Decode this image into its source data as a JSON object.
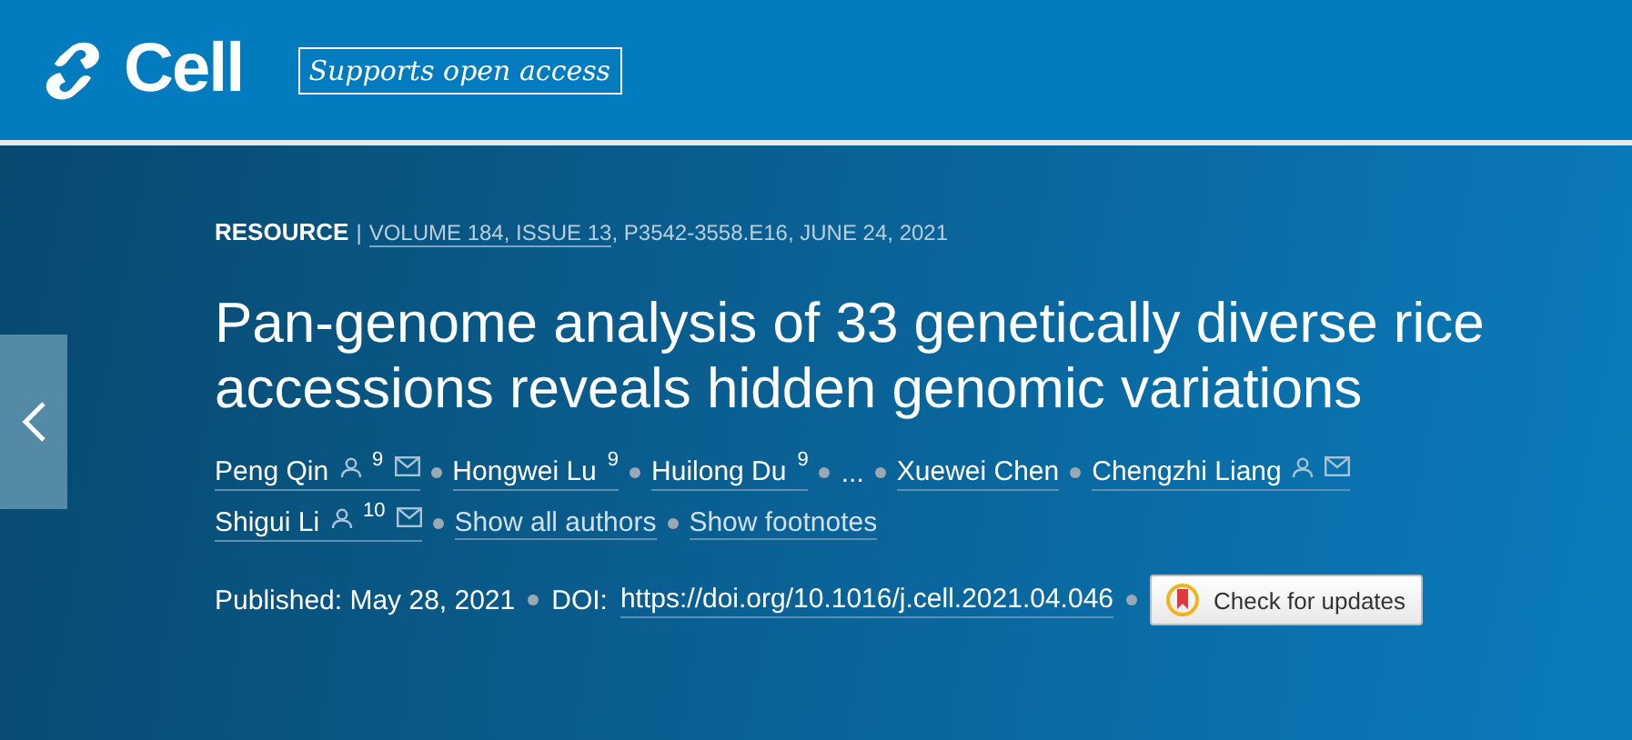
{
  "header": {
    "brand": "Cell",
    "badge": "Supports open access"
  },
  "article": {
    "type": "RESOURCE",
    "divider": "|",
    "issue_link": "VOLUME 184, ISSUE 13",
    "issue_rest": ", P3542-3558.E16, JUNE 24, 2021",
    "title": "Pan-genome analysis of 33 genetically diverse rice accessions reveals hidden genomic variations",
    "author_lines": [
      [
        {
          "kind": "author",
          "name": "Peng Qin",
          "person": true,
          "note": "9",
          "email": true
        },
        {
          "kind": "author",
          "name": "Hongwei Lu",
          "person": false,
          "note": "9",
          "email": false
        },
        {
          "kind": "author",
          "name": "Huilong Du",
          "person": false,
          "note": "9",
          "email": false
        },
        {
          "kind": "ellipsis",
          "name": "..."
        },
        {
          "kind": "author",
          "name": "Xuewei Chen",
          "person": false,
          "email": false
        },
        {
          "kind": "author",
          "name": "Chengzhi Liang",
          "person": true,
          "email": true
        }
      ],
      [
        {
          "kind": "author",
          "name": "Shigui Li",
          "person": true,
          "note": "10",
          "email": true
        },
        {
          "kind": "link",
          "name": "Show all authors"
        },
        {
          "kind": "link",
          "name": "Show footnotes"
        }
      ]
    ],
    "published": "Published: May 28, 2021",
    "doi_label": "DOI:",
    "doi": "https://doi.org/10.1016/j.cell.2021.04.046",
    "updates_button": "Check for updates"
  }
}
